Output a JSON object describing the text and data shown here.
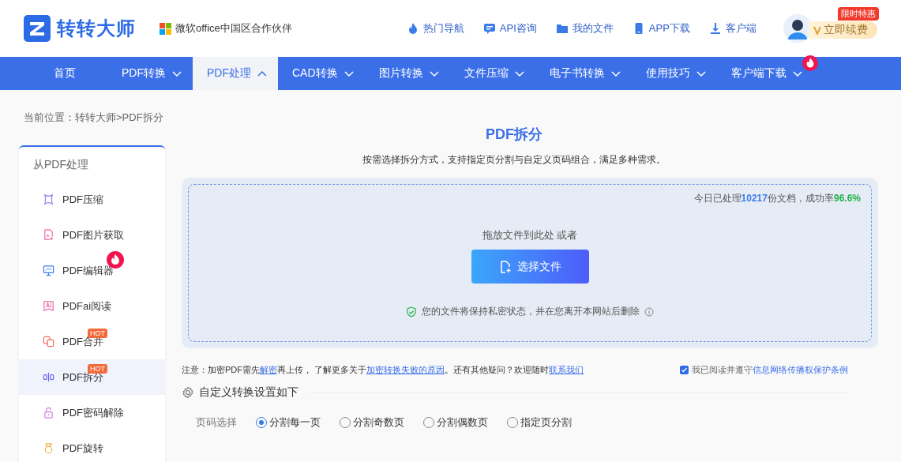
{
  "header": {
    "brand": "转转大师",
    "partner": "微软office中国区合作伙伴",
    "links": [
      {
        "label": "热门导航"
      },
      {
        "label": "API咨询"
      },
      {
        "label": "我的文件"
      },
      {
        "label": "APP下载"
      },
      {
        "label": "客户端"
      }
    ],
    "promo_badge": "限时特惠",
    "renew": "立即续费"
  },
  "nav": [
    {
      "label": "首页",
      "kind": "link",
      "selected": false
    },
    {
      "label": "PDF转换",
      "kind": "menu",
      "expanded": false,
      "selected": false
    },
    {
      "label": "PDF处理",
      "kind": "menu",
      "expanded": true,
      "selected": true
    },
    {
      "label": "CAD转换",
      "kind": "menu",
      "expanded": false,
      "selected": false
    },
    {
      "label": "图片转换",
      "kind": "menu",
      "expanded": false,
      "selected": false
    },
    {
      "label": "文件压缩",
      "kind": "menu",
      "expanded": false,
      "selected": false
    },
    {
      "label": "电子书转换",
      "kind": "menu",
      "expanded": false,
      "selected": false
    },
    {
      "label": "使用技巧",
      "kind": "menu",
      "expanded": false,
      "selected": false
    },
    {
      "label": "客户端下载",
      "kind": "menu",
      "expanded": false,
      "selected": false,
      "badge": {
        "kind": "fire"
      }
    }
  ],
  "breadcrumb": "当前位置：转转大师>PDF拆分",
  "sidebar": {
    "heading": "从PDF处理",
    "items": [
      {
        "label": "PDF压缩",
        "selected": false
      },
      {
        "label": "PDF图片获取",
        "selected": false
      },
      {
        "label": "PDF编辑器",
        "selected": false,
        "badge": {
          "kind": "fire"
        }
      },
      {
        "label": "PDFai阅读",
        "selected": false
      },
      {
        "label": "PDF合并",
        "selected": false,
        "badge": {
          "kind": "hot",
          "text": "HOT"
        }
      },
      {
        "label": "PDF拆分",
        "selected": true,
        "badge": {
          "kind": "hot",
          "text": "HOT"
        }
      },
      {
        "label": "PDF密码解除",
        "selected": false
      },
      {
        "label": "PDF旋转",
        "selected": false
      }
    ]
  },
  "tool": {
    "title": "PDF拆分",
    "subtitle": "按需选择拆分方式，支持指定页分割与自定义页码组合，满足多种需求。",
    "stats": {
      "prefix": "今日已处理",
      "count": "10217",
      "middle": "份文档，成功率",
      "rate": "96.6%"
    },
    "drop_hint": "拖放文件到此处 或者",
    "button": "选择文件",
    "privacy": "您的文件将保持私密状态，并在您离开本网站后删除",
    "notice": [
      {
        "text": "注意：加密PDF需先",
        "link": false
      },
      {
        "text": "解密",
        "link": true
      },
      {
        "text": "再上传， 了解更多关于",
        "link": false
      },
      {
        "text": "加密转换失败的原因",
        "link": true
      },
      {
        "text": "。还有其他疑问？欢迎随时",
        "link": false
      },
      {
        "text": "联系我们",
        "link": true
      }
    ],
    "agreement": {
      "checked": true,
      "text": "我已阅读并遵守",
      "link": "信息网络传播权保护条例"
    },
    "settings_title": "自定义转换设置如下",
    "page_label": "页码选择",
    "options": [
      {
        "label": "分割每一页",
        "selected": true
      },
      {
        "label": "分割奇数页",
        "selected": false
      },
      {
        "label": "分割偶数页",
        "selected": false
      },
      {
        "label": "指定页分割",
        "selected": false
      }
    ]
  }
}
